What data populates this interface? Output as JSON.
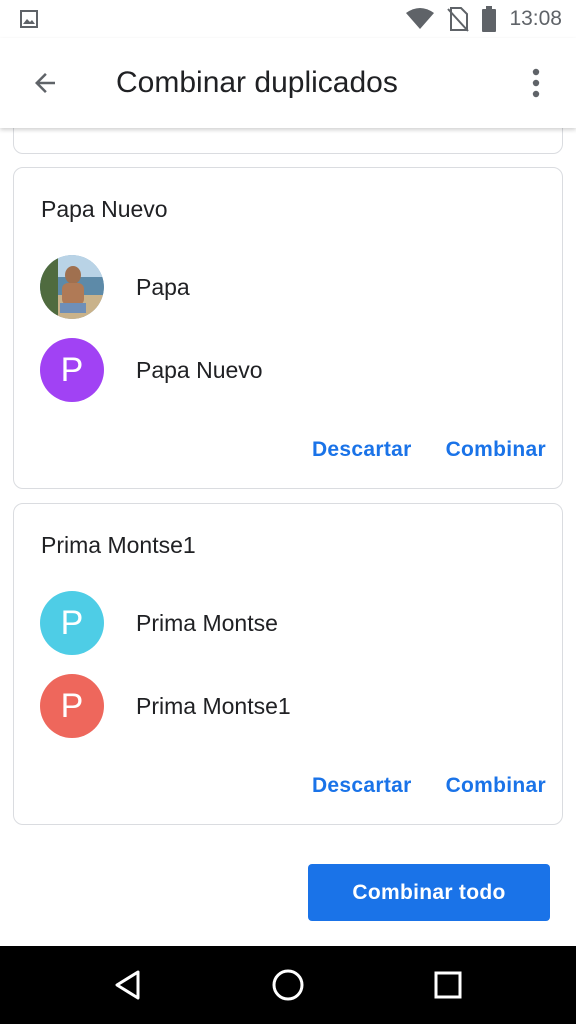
{
  "status_bar": {
    "time": "13:08",
    "icons": [
      "gallery-icon",
      "wifi-icon",
      "no-sim-icon",
      "battery-icon"
    ]
  },
  "app_bar": {
    "title": "Combinar duplicados",
    "icons": [
      "back-arrow-icon",
      "more-vert-icon"
    ]
  },
  "cards": [
    {
      "title": "Papa Nuevo",
      "contacts": [
        {
          "name": "Papa",
          "avatar": "photo"
        },
        {
          "name": "Papa Nuevo",
          "avatar_letter": "P",
          "avatar_color": "#a142f4"
        }
      ],
      "dismiss_label": "Descartar",
      "merge_label": "Combinar"
    },
    {
      "title": "Prima Montse1",
      "contacts": [
        {
          "name": "Prima Montse",
          "avatar_letter": "P",
          "avatar_color": "#4ecde6"
        },
        {
          "name": "Prima Montse1",
          "avatar_letter": "P",
          "avatar_color": "#ee675c"
        }
      ],
      "dismiss_label": "Descartar",
      "merge_label": "Combinar"
    }
  ],
  "merge_all_label": "Combinar todo",
  "colors": {
    "accent": "#1a73e8",
    "nav_bar": "#000000"
  },
  "nav": [
    "back-triangle-icon",
    "home-circle-icon",
    "recents-square-icon"
  ]
}
